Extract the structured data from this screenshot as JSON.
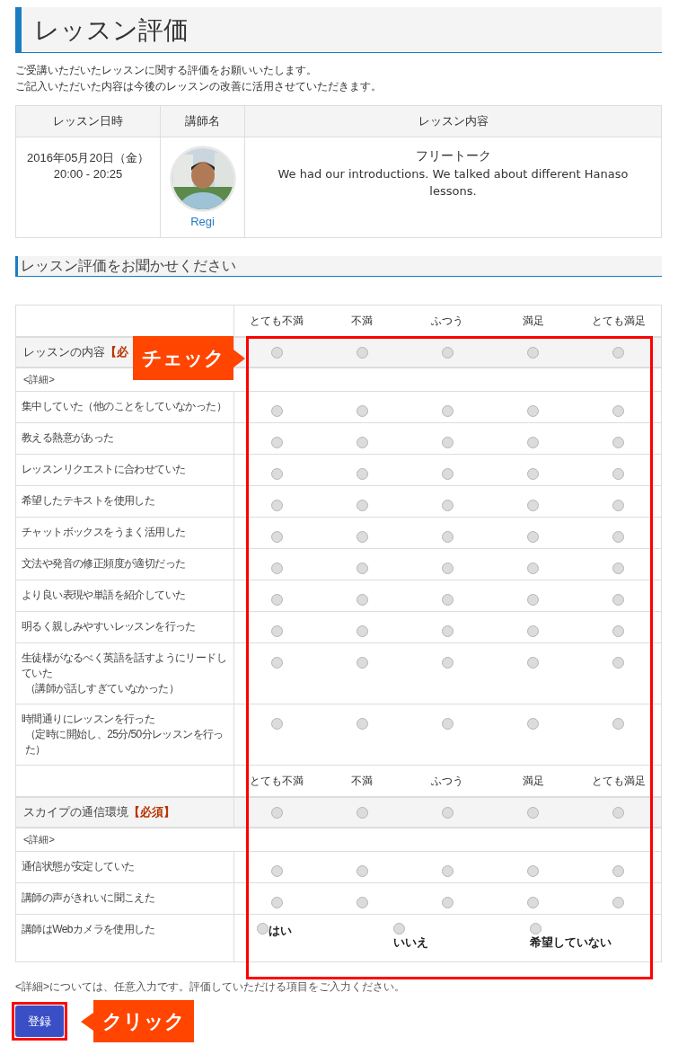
{
  "page_title": "レッスン評価",
  "intro": [
    "ご受講いただいたレッスンに関する評価をお願いいたします。",
    "ご記入いただいた内容は今後のレッスンの改善に活用させていただきます。"
  ],
  "lesson_table": {
    "columns": [
      "レッスン日時",
      "講師名",
      "レッスン内容"
    ],
    "row": {
      "date": "2016年05月20日（金）",
      "time": "20:00 - 20:25",
      "teacher": "Regi",
      "topic": "フリートーク",
      "comment": "We had our introductions. We talked about different Hanaso lessons."
    }
  },
  "section_heading": "レッスン評価をお聞かせください",
  "rating_groups": [
    {
      "columns": [
        "とても不満",
        "不満",
        "ふつう",
        "満足",
        "とても満足"
      ],
      "title": "レッスンの内容",
      "required_mark": "【必",
      "overall_selected": [
        false,
        false,
        false,
        false,
        false
      ],
      "detail_label": "<詳細>",
      "items": [
        {
          "kind": "rating",
          "lines": [
            "集中していた（他のことをしていなかった）"
          ],
          "selected": [
            false,
            false,
            false,
            false,
            false
          ]
        },
        {
          "kind": "rating",
          "lines": [
            "教える熱意があった"
          ],
          "selected": [
            false,
            false,
            false,
            false,
            false
          ]
        },
        {
          "kind": "rating",
          "lines": [
            "レッスンリクエストに合わせていた"
          ],
          "selected": [
            false,
            false,
            false,
            false,
            false
          ]
        },
        {
          "kind": "rating",
          "lines": [
            "希望したテキストを使用した"
          ],
          "selected": [
            false,
            false,
            false,
            false,
            false
          ]
        },
        {
          "kind": "rating",
          "lines": [
            "チャットボックスをうまく活用した"
          ],
          "selected": [
            false,
            false,
            false,
            false,
            false
          ]
        },
        {
          "kind": "rating",
          "lines": [
            "文法や発音の修正頻度が適切だった"
          ],
          "selected": [
            false,
            false,
            false,
            false,
            false
          ]
        },
        {
          "kind": "rating",
          "lines": [
            "より良い表現や単語を紹介していた"
          ],
          "selected": [
            false,
            false,
            false,
            false,
            false
          ]
        },
        {
          "kind": "rating",
          "lines": [
            "明るく親しみやすいレッスンを行った"
          ],
          "selected": [
            false,
            false,
            false,
            false,
            false
          ]
        },
        {
          "kind": "rating",
          "lines": [
            "生徒様がなるべく英語を話すようにリードしていた",
            "（講師が話しすぎていなかった）"
          ],
          "selected": [
            false,
            false,
            false,
            false,
            false
          ]
        },
        {
          "kind": "rating",
          "lines": [
            "時間通りにレッスンを行った",
            "（定時に開始し、25分/50分レッスンを行った）"
          ],
          "selected": [
            false,
            false,
            false,
            false,
            false
          ]
        }
      ]
    },
    {
      "columns": [
        "とても不満",
        "不満",
        "ふつう",
        "満足",
        "とても満足"
      ],
      "title": "スカイプの通信環境",
      "required_mark": "【必須】",
      "overall_selected": [
        false,
        false,
        false,
        false,
        false
      ],
      "detail_label": "<詳細>",
      "items": [
        {
          "kind": "rating",
          "lines": [
            "通信状態が安定していた"
          ],
          "selected": [
            false,
            false,
            false,
            false,
            false
          ]
        },
        {
          "kind": "rating",
          "lines": [
            "講師の声がきれいに聞こえた"
          ],
          "selected": [
            false,
            false,
            false,
            false,
            false
          ]
        },
        {
          "kind": "choice",
          "lines": [
            "講師はWebカメラを使用した"
          ],
          "options": [
            {
              "label": "はい",
              "selected": false
            },
            {
              "label": "いいえ",
              "selected": false
            },
            {
              "label": "希望していない",
              "selected": false
            }
          ]
        }
      ]
    }
  ],
  "note": "<詳細>については、任意入力です。評価していただける項目をご入力ください。",
  "submit_button": "登録",
  "annotations": [
    {
      "kind": "check",
      "text": "チェック"
    },
    {
      "kind": "click",
      "text": "クリック"
    }
  ]
}
